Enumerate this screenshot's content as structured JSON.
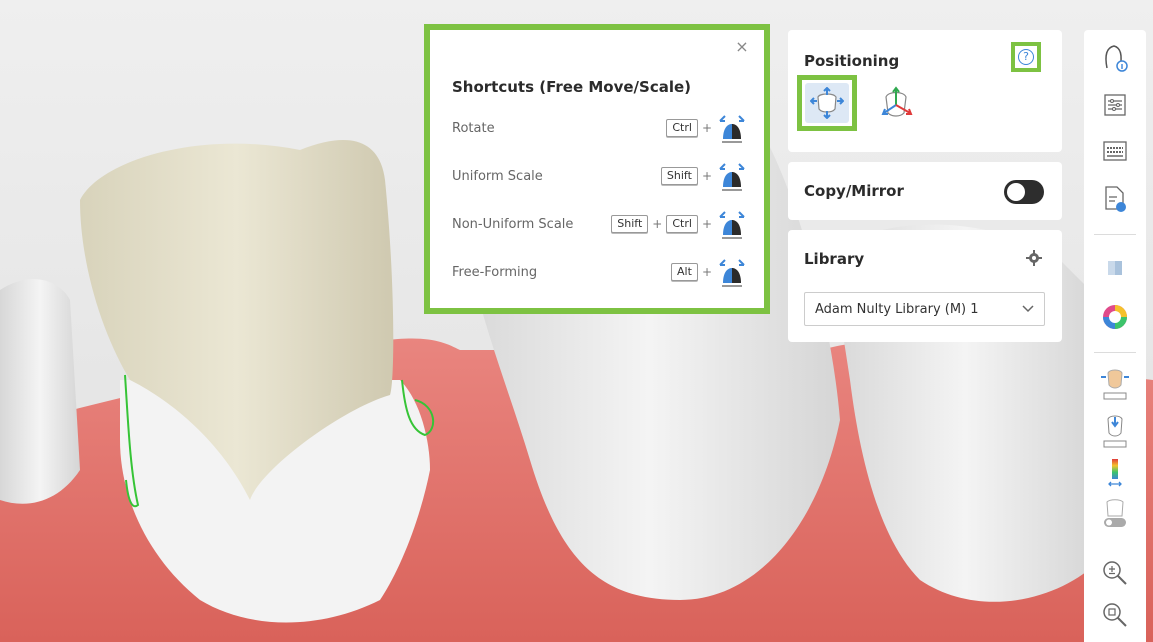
{
  "shortcuts": {
    "title": "Shortcuts (Free Move/Scale)",
    "close_label": "×",
    "plus": "+",
    "rows": [
      {
        "label": "Rotate",
        "keys": [
          "Ctrl"
        ]
      },
      {
        "label": "Uniform Scale",
        "keys": [
          "Shift"
        ]
      },
      {
        "label": "Non-Uniform Scale",
        "keys": [
          "Shift",
          "Ctrl"
        ]
      },
      {
        "label": "Free-Forming",
        "keys": [
          "Alt"
        ]
      }
    ]
  },
  "positioning": {
    "title": "Positioning",
    "help_label": "?",
    "tools": [
      {
        "icon": "free-move-scale-icon",
        "active": true
      },
      {
        "icon": "axis-move-icon",
        "active": false
      }
    ]
  },
  "copy_mirror": {
    "title": "Copy/Mirror",
    "enabled": false
  },
  "library": {
    "title": "Library",
    "selected": "Adam Nulty Library (M) 1"
  },
  "toolbar": {
    "icons": [
      "tooth-info-icon",
      "sliders-icon",
      "keyboard-icon",
      "document-icon",
      "cube-icon",
      "color-wheel-icon",
      "adapt-crown-icon",
      "adjust-crown-icon",
      "heatmap-icon",
      "tooth-off-icon",
      "zoom-in-icon",
      "zoom-fit-icon"
    ]
  },
  "colors": {
    "accent_highlight": "#7dc242",
    "active_blue": "#3d86d8",
    "gum": "#e0706a",
    "crown": "#e3dfca"
  }
}
